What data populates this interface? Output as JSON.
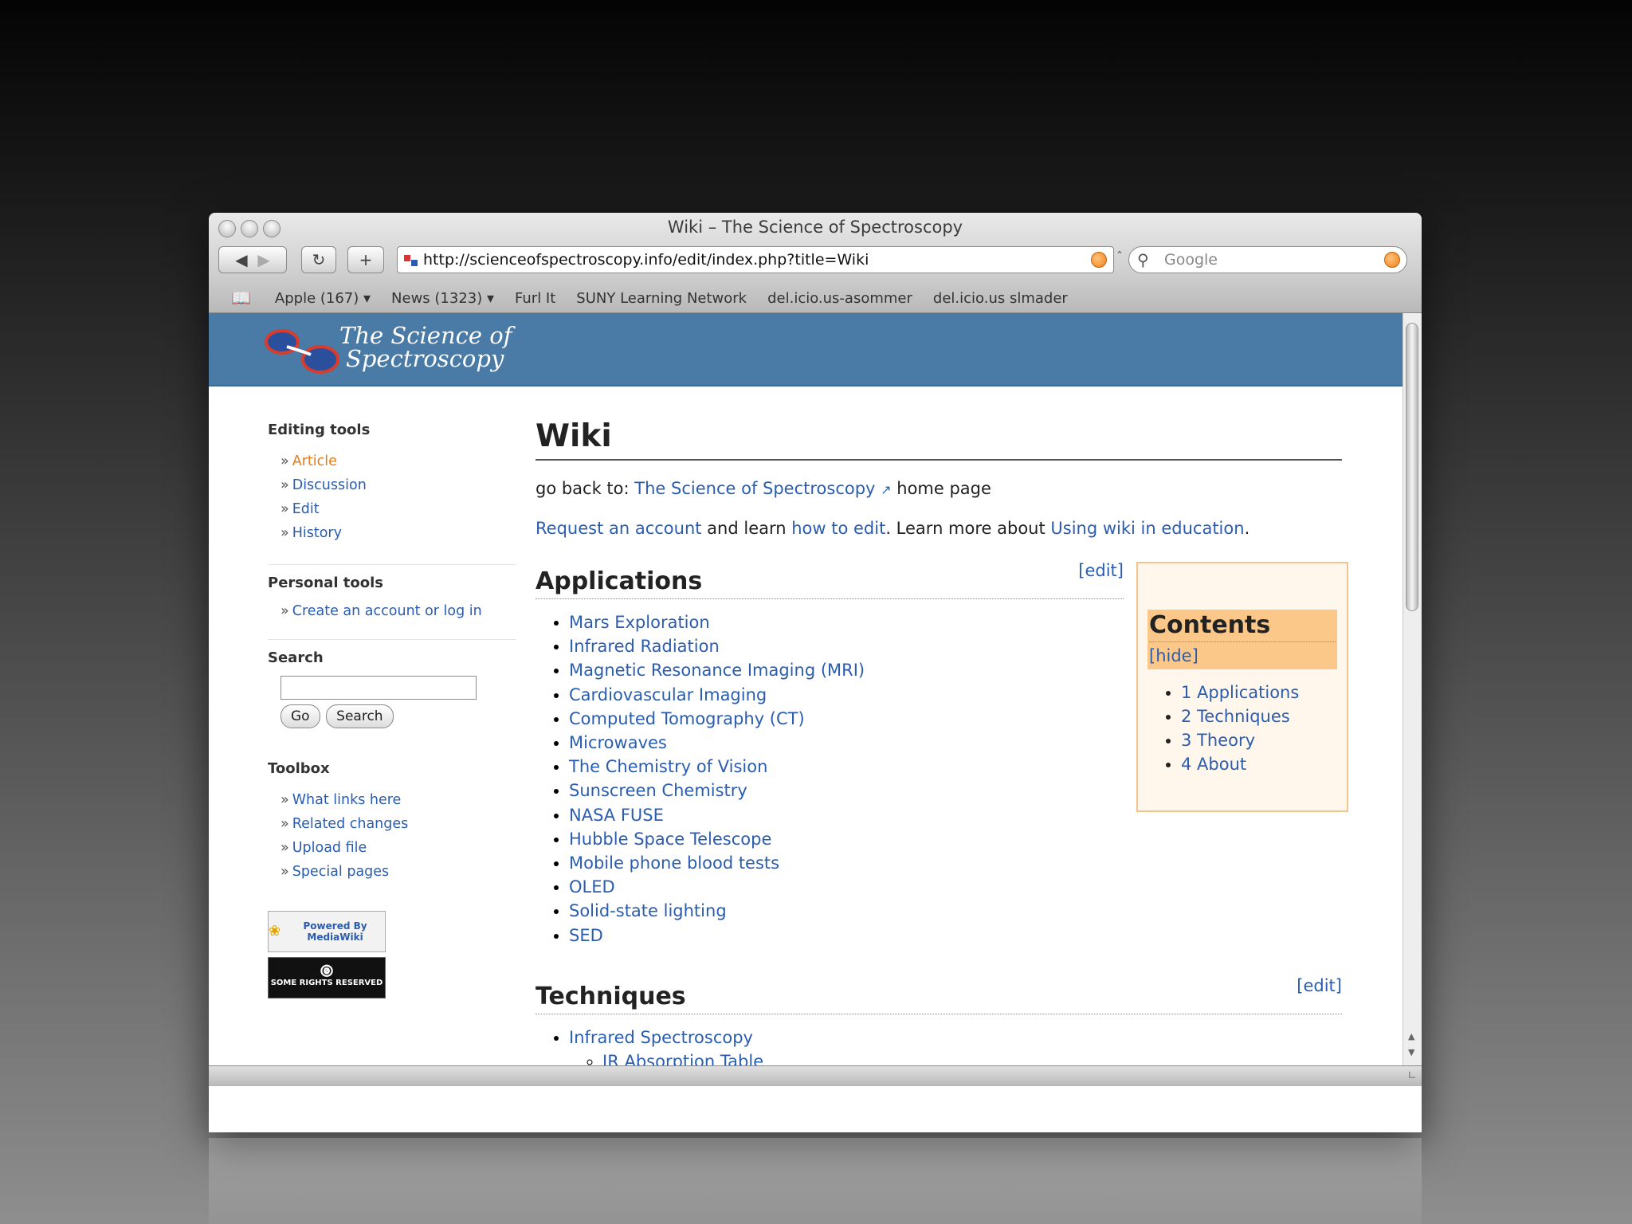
{
  "window": {
    "title": "Wiki – The Science of Spectroscopy"
  },
  "toolbar": {
    "url": "http://scienceofspectroscopy.info/edit/index.php?title=Wiki",
    "search_placeholder": "Google"
  },
  "bookmarks": [
    {
      "label": "Apple (167) ▾"
    },
    {
      "label": "News (1323) ▾"
    },
    {
      "label": "Furl It"
    },
    {
      "label": "SUNY Learning Network"
    },
    {
      "label": "del.icio.us-asommer"
    },
    {
      "label": "del.icio.us slmader"
    }
  ],
  "banner": {
    "line1": "The Science of",
    "line2": "Spectroscopy"
  },
  "sidebar": {
    "editing_title": "Editing tools",
    "editing": [
      "Article",
      "Discussion",
      "Edit",
      "History"
    ],
    "personal_title": "Personal tools",
    "personal": [
      "Create an account or log in"
    ],
    "search_title": "Search",
    "go_label": "Go",
    "search_label": "Search",
    "toolbox_title": "Toolbox",
    "toolbox": [
      "What links here",
      "Related changes",
      "Upload file",
      "Special pages"
    ],
    "badge_mediawiki": "Powered By MediaWiki",
    "badge_cc": "SOME RIGHTS RESERVED"
  },
  "main": {
    "title": "Wiki",
    "goback_prefix": "go back to: ",
    "goback_link": "The Science of Spectroscopy",
    "goback_suffix": " home page",
    "request_link": "Request an account",
    "and_learn": " and learn ",
    "howto_link": "how to edit",
    "learn_more": ". Learn more about ",
    "wiki_edu_link": "Using wiki in education",
    "period": ".",
    "edit_label": "[edit]",
    "applications_title": "Applications",
    "applications": [
      "Mars Exploration",
      "Infrared Radiation",
      "Magnetic Resonance Imaging (MRI)",
      "Cardiovascular Imaging",
      "Computed Tomography (CT)",
      "Microwaves",
      "The Chemistry of Vision",
      "Sunscreen Chemistry",
      "NASA FUSE",
      "Hubble Space Telescope",
      "Mobile phone blood tests",
      "OLED",
      "Solid-state lighting",
      "SED"
    ],
    "techniques_title": "Techniques",
    "techniques": [
      "Infrared Spectroscopy"
    ],
    "techniques_sub": [
      "IR Absorption Table"
    ]
  },
  "toc": {
    "title": "Contents",
    "hide_open": "[",
    "hide_label": "hide",
    "hide_close": "]",
    "items": [
      "1 Applications",
      "2 Techniques",
      "3 Theory",
      "4 About"
    ]
  },
  "colors": {
    "banner": "#4a7aa6",
    "link": "#2a5db0",
    "active": "#e77a10",
    "toc_bg": "#fff7ec",
    "toc_head": "#fbc88a"
  }
}
